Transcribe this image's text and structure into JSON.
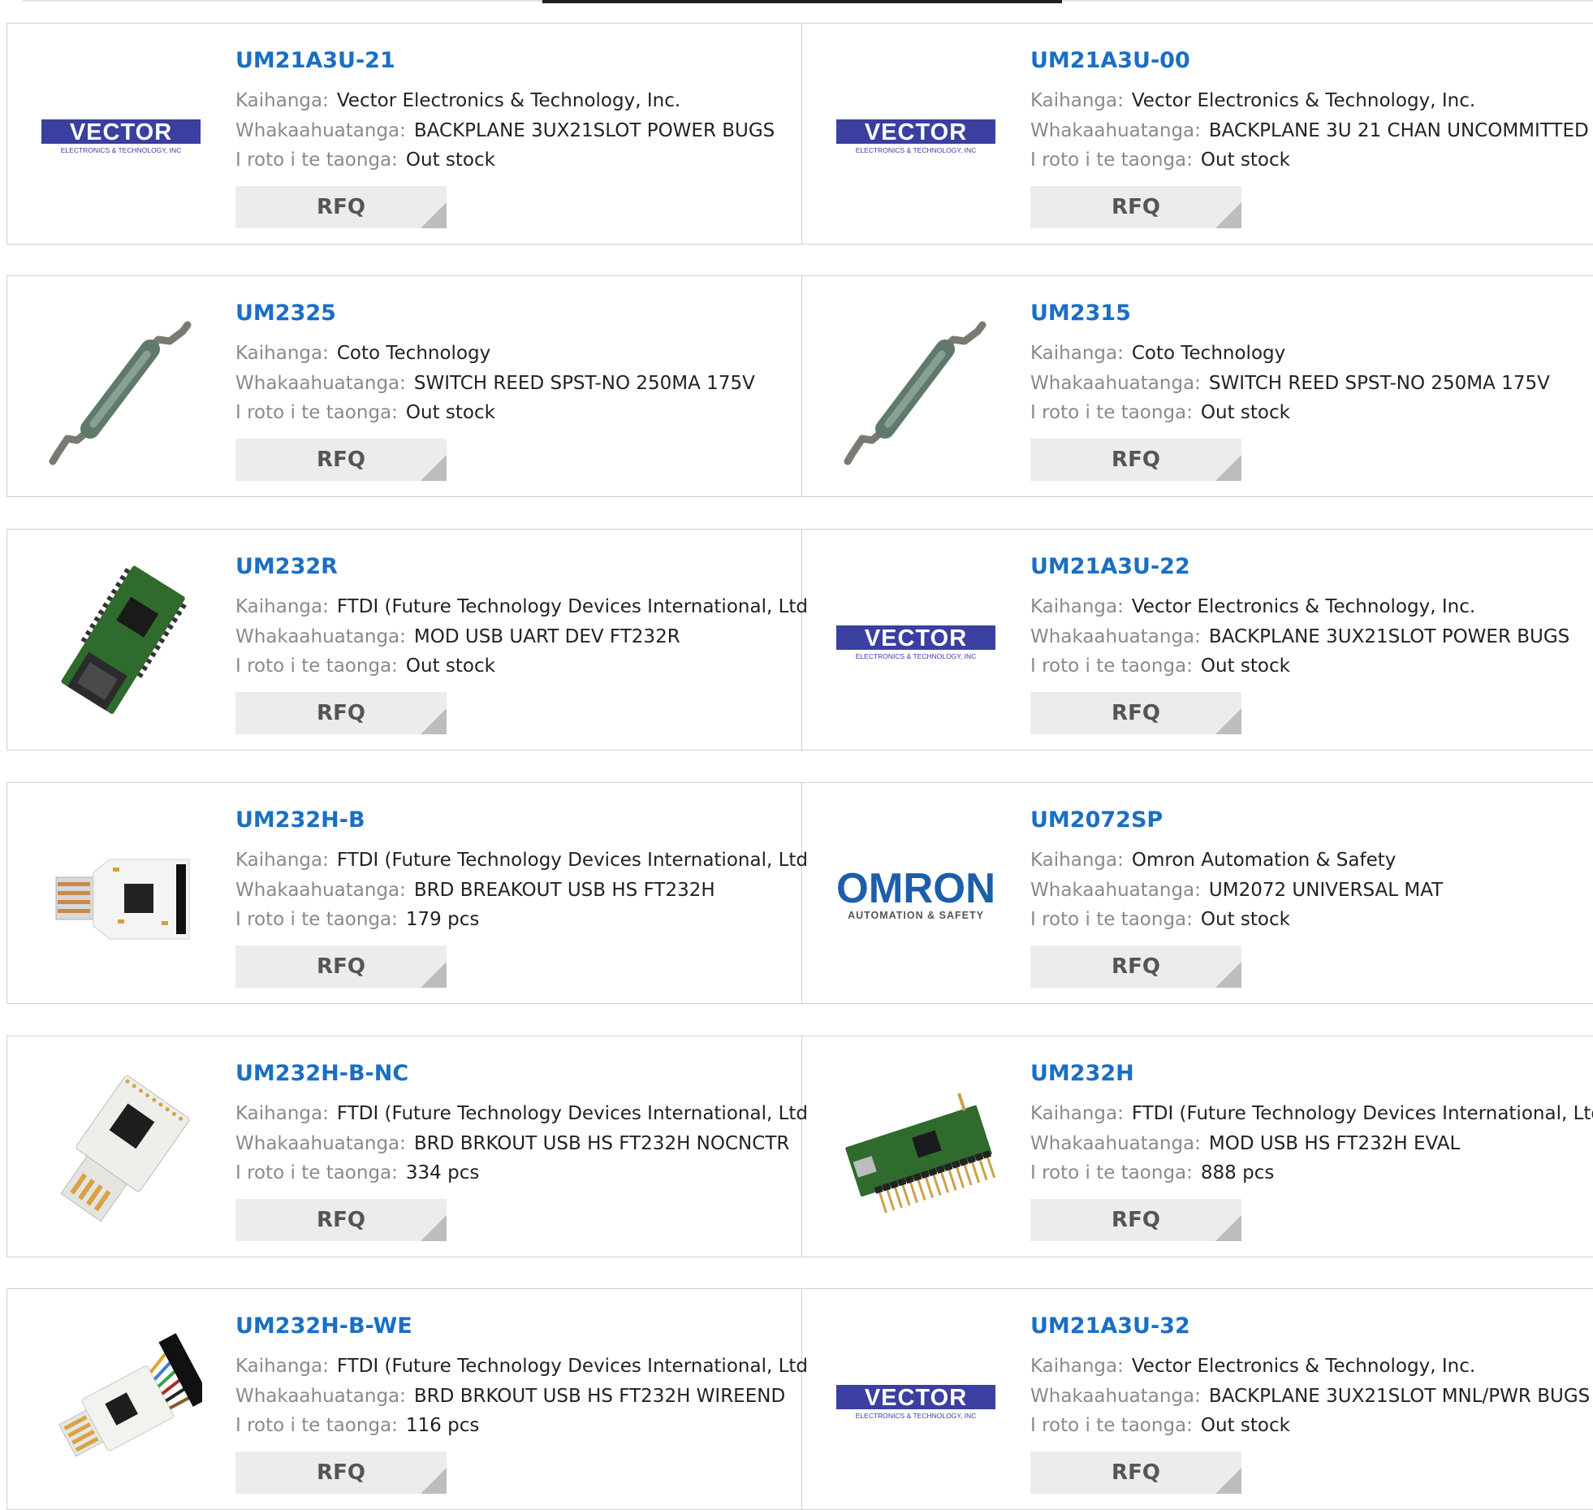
{
  "labels": {
    "manufacturer": "Kaihanga:",
    "description": "Whakaahuatanga:",
    "stock": "I roto i te taonga:",
    "rfq": "RFQ"
  },
  "products": [
    {
      "part": "UM21A3U-21",
      "manufacturer": "Vector Electronics & Technology, Inc.",
      "description": "BACKPLANE 3UX21SLOT POWER BUGS",
      "stock": "Out stock",
      "image": "vector-logo",
      "logo_text": "VECTOR",
      "logo_sub": "ELECTRONICS & TECHNOLOGY, INC"
    },
    {
      "part": "UM21A3U-00",
      "manufacturer": "Vector Electronics & Technology, Inc.",
      "description": "BACKPLANE 3U 21 CHAN UNCOMMITTED",
      "stock": "Out stock",
      "image": "vector-logo",
      "logo_text": "VECTOR",
      "logo_sub": "ELECTRONICS & TECHNOLOGY, INC"
    },
    {
      "part": "UM2325",
      "manufacturer": "Coto Technology",
      "description": "SWITCH REED SPST-NO 250MA 175V",
      "stock": "Out stock",
      "image": "reed-switch"
    },
    {
      "part": "UM2315",
      "manufacturer": "Coto Technology",
      "description": "SWITCH REED SPST-NO 250MA 175V",
      "stock": "Out stock",
      "image": "reed-switch"
    },
    {
      "part": "UM232R",
      "manufacturer": "FTDI (Future Technology Devices International, Ltd",
      "description": "MOD USB UART DEV FT232R",
      "stock": "Out stock",
      "image": "green-usb-module"
    },
    {
      "part": "UM21A3U-22",
      "manufacturer": "Vector Electronics & Technology, Inc.",
      "description": "BACKPLANE 3UX21SLOT POWER BUGS",
      "stock": "Out stock",
      "image": "vector-logo",
      "logo_text": "VECTOR",
      "logo_sub": "ELECTRONICS & TECHNOLOGY, INC"
    },
    {
      "part": "UM232H-B",
      "manufacturer": "FTDI (Future Technology Devices International, Ltd",
      "description": "BRD BREAKOUT USB HS FT232H",
      "stock": "179 pcs",
      "image": "white-usb-board"
    },
    {
      "part": "UM2072SP",
      "manufacturer": "Omron Automation & Safety",
      "description": "UM2072 UNIVERSAL MAT",
      "stock": "Out stock",
      "image": "omron-logo",
      "logo_text": "OMRON",
      "logo_sub": "AUTOMATION & SAFETY"
    },
    {
      "part": "UM232H-B-NC",
      "manufacturer": "FTDI (Future Technology Devices International, Ltd",
      "description": "BRD BRKOUT USB HS FT232H NOCNCTR",
      "stock": "334 pcs",
      "image": "white-usb-stick"
    },
    {
      "part": "UM232H",
      "manufacturer": "FTDI (Future Technology Devices International, Ltd",
      "description": "MOD USB HS FT232H EVAL",
      "stock": "888 pcs",
      "image": "green-module-pins"
    },
    {
      "part": "UM232H-B-WE",
      "manufacturer": "FTDI (Future Technology Devices International, Ltd",
      "description": "BRD BRKOUT USB HS FT232H WIREEND",
      "stock": "116 pcs",
      "image": "white-usb-wires"
    },
    {
      "part": "UM21A3U-32",
      "manufacturer": "Vector Electronics & Technology, Inc.",
      "description": "BACKPLANE 3UX21SLOT MNL/PWR BUGS",
      "stock": "Out stock",
      "image": "vector-logo",
      "logo_text": "VECTOR",
      "logo_sub": "ELECTRONICS & TECHNOLOGY, INC"
    }
  ],
  "colors": {
    "title": "#1a6fc4",
    "vector_brand": "#3a3fa0",
    "omron_brand": "#1d5ea8",
    "pcb_green": "#2f6b2c"
  }
}
